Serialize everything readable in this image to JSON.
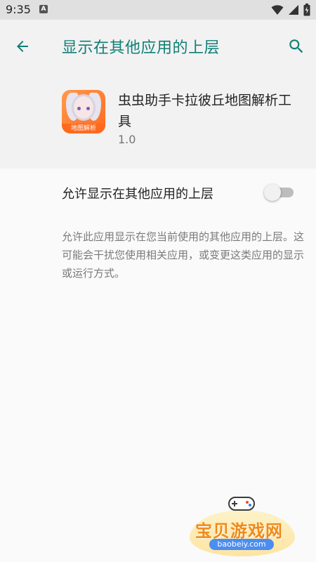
{
  "status_bar": {
    "time": "9:35",
    "notification_badge": "A",
    "icons": [
      "wifi-icon",
      "signal-icon",
      "battery-icon"
    ]
  },
  "app_bar": {
    "title": "显示在其他应用的上层",
    "back_icon": "arrow-back-icon",
    "search_icon": "search-icon"
  },
  "app_info": {
    "name": "虫虫助手卡拉彼丘地图解析工具",
    "icon_banner": "地图解析",
    "version": "1.0"
  },
  "permission": {
    "label": "允许显示在其他应用的上层",
    "enabled": false,
    "description": "允许此应用显示在您当前使用的其他应用的上层。这可能会干扰您使用相关应用，或变更这类应用的显示或运行方式。"
  },
  "watermark": {
    "title": "宝贝游戏网",
    "url": "baobeiy.com"
  },
  "colors": {
    "accent": "#0f7f75",
    "toggle_off_track": "#bdbdbd",
    "status_bar_bg": "#e0e0e0"
  }
}
